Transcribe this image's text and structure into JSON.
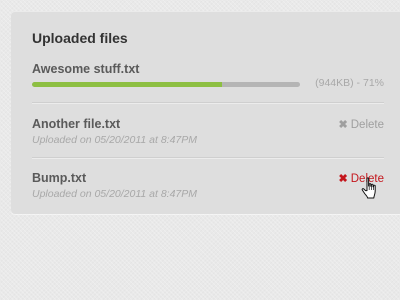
{
  "panel": {
    "title": "Uploaded files"
  },
  "uploading": {
    "name": "Awesome stuff.txt",
    "progress": 0.71,
    "status": "(944KB) - 71%"
  },
  "files": [
    {
      "name": "Another file.txt",
      "uploaded": "Uploaded on 05/20/2011 at 8:47PM",
      "delete_icon": "✖",
      "delete_label": "Delete",
      "state": "normal"
    },
    {
      "name": "Bump.txt",
      "uploaded": "Uploaded on 05/20/2011 at 8:47PM",
      "delete_icon": "✖",
      "delete_label": "Delete",
      "state": "hover"
    }
  ],
  "colors": {
    "progress": "#8dbf42",
    "delete_hover": "#c4161c",
    "delete_normal": "#9f9f9f"
  },
  "icons": {
    "delete": "close-icon",
    "cursor": "hand-pointer-cursor"
  }
}
